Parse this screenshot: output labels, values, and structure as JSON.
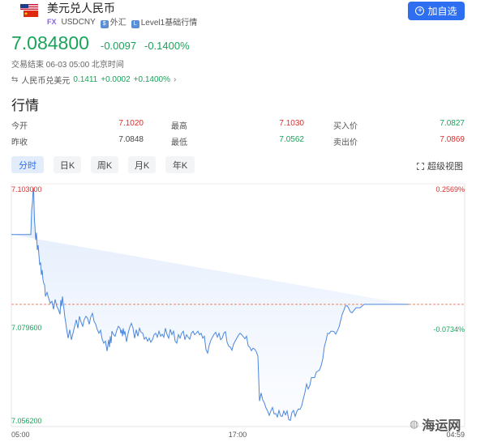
{
  "header": {
    "title": "美元兑人民币",
    "market_tag": "FX",
    "symbol": "USDCNY",
    "category": "外汇",
    "level_label": "Level1基础行情",
    "add_button": "加自选"
  },
  "quote": {
    "price": "7.084800",
    "change": "-0.0097",
    "change_pct": "-0.1400%",
    "status": "交易结束 06-03 05:00 北京时间"
  },
  "inverse": {
    "label": "人民币兑美元",
    "price": "0.1411",
    "change": "+0.0002",
    "change_pct": "+0.1400%"
  },
  "section_title": "行情",
  "stats": {
    "open_label": "今开",
    "open": "7.1020",
    "high_label": "最高",
    "high": "7.1030",
    "bid_label": "买入价",
    "bid": "7.0827",
    "prev_label": "昨收",
    "prev": "7.0848",
    "low_label": "最低",
    "low": "7.0562",
    "ask_label": "卖出价",
    "ask": "7.0869"
  },
  "tabs": [
    "分时",
    "日K",
    "周K",
    "月K",
    "年K"
  ],
  "super_view": "超级视图",
  "watermark": "海运网",
  "colors": {
    "up": "#d93030",
    "down": "#1aa35b",
    "accent": "#2d6ff0",
    "line": "#4a86e0"
  },
  "chart_data": {
    "type": "line",
    "y_left_labels": [
      "7.103000",
      "7.079600",
      "7.056200"
    ],
    "y_right_labels": [
      "0.2569%",
      "-0.0734%"
    ],
    "x_labels": [
      "05:00",
      "17:00",
      "04:59"
    ],
    "ylim": [
      7.0562,
      7.103
    ],
    "reference": 7.0796,
    "x": [
      0,
      24,
      25,
      26,
      27,
      27.5,
      28,
      28.5,
      29,
      29.5,
      30,
      31,
      32,
      33,
      34,
      35,
      36,
      37,
      38,
      39,
      40,
      41,
      42,
      44,
      46,
      48,
      50,
      52,
      54,
      56,
      58,
      60,
      61,
      62,
      63,
      64,
      65,
      66,
      67,
      68,
      69,
      70,
      72,
      74,
      76,
      78,
      80,
      82,
      84,
      86,
      88,
      90,
      92,
      94,
      96,
      98,
      100,
      102,
      104,
      106,
      108,
      110,
      112,
      114,
      116,
      118,
      120,
      121,
      122,
      123,
      124,
      126,
      128,
      130,
      132,
      134,
      135,
      136,
      137,
      138,
      139,
      140,
      142,
      144,
      146,
      148,
      150,
      152,
      154,
      156,
      158,
      160,
      162,
      164,
      166,
      168,
      170,
      172,
      174,
      176,
      178,
      180,
      182,
      184,
      186,
      188,
      190,
      192,
      194,
      196,
      198,
      200,
      202,
      204,
      206,
      208,
      210,
      212,
      214,
      216,
      218,
      220,
      222,
      224,
      226,
      228,
      230,
      232,
      234,
      236,
      238,
      240,
      242,
      244,
      246,
      248,
      250,
      252,
      254,
      256,
      258,
      260,
      262,
      264,
      266,
      268,
      270,
      272,
      274,
      276,
      278,
      280,
      282,
      284,
      286,
      288,
      290,
      292,
      294,
      296,
      298,
      300,
      302,
      304,
      306,
      308,
      310,
      312,
      314,
      316,
      318,
      320,
      322,
      324,
      326,
      328,
      330,
      332,
      334,
      336,
      338,
      340,
      342,
      344,
      346,
      348,
      350,
      352,
      354,
      356,
      358,
      360,
      362,
      364,
      366,
      368,
      370,
      372,
      374,
      376,
      378,
      380,
      382,
      384,
      386,
      388,
      390,
      392,
      394,
      396,
      398,
      400,
      402,
      404,
      406,
      408,
      410,
      412,
      414,
      416,
      418,
      420,
      425,
      430,
      435,
      440,
      445,
      450,
      455,
      460,
      470,
      480,
      490,
      500,
      510,
      519
    ],
    "values": [
      7.0936,
      7.0936,
      7.0985,
      7.1,
      7.103,
      7.1025,
      7.0995,
      7.0965,
      7.0955,
      7.094,
      7.0925,
      7.094,
      7.0905,
      7.0915,
      7.0895,
      7.0875,
      7.088,
      7.0855,
      7.0865,
      7.0845,
      7.0838,
      7.0835,
      7.0812,
      7.082,
      7.0808,
      7.0798,
      7.0802,
      7.0786,
      7.0806,
      7.0792,
      7.0786,
      7.0776,
      7.0805,
      7.0792,
      7.0812,
      7.0798,
      7.0785,
      7.077,
      7.076,
      7.0748,
      7.0738,
      7.0728,
      7.0745,
      7.0725,
      7.0738,
      7.0752,
      7.0765,
      7.0748,
      7.0772,
      7.076,
      7.0752,
      7.0766,
      7.0772,
      7.0768,
      7.0756,
      7.0771,
      7.0778,
      7.0762,
      7.0756,
      7.0745,
      7.0738,
      7.0744,
      7.0726,
      7.0718,
      7.0722,
      7.0702,
      7.0725,
      7.071,
      7.0732,
      7.0718,
      7.0742,
      7.0735,
      7.0732,
      7.0744,
      7.0752,
      7.0748,
      7.0738,
      7.0745,
      7.0732,
      7.0748,
      7.0735,
      7.0742,
      7.0721,
      7.0738,
      7.075,
      7.0758,
      7.0748,
      7.0728,
      7.0745,
      7.0732,
      7.0748,
      7.074,
      7.0738,
      7.0726,
      7.073,
      7.0722,
      7.0728,
      7.072,
      7.0725,
      7.0735,
      7.0738,
      7.073,
      7.0742,
      7.0732,
      7.0736,
      7.073,
      7.0748,
      7.0735,
      7.0728,
      7.0746,
      7.0735,
      7.0742,
      7.0722,
      7.0718,
      7.0735,
      7.0728,
      7.0738,
      7.0742,
      7.0725,
      7.0735,
      7.073,
      7.0726,
      7.0738,
      7.0742,
      7.0735,
      7.0738,
      7.0742,
      7.0735,
      7.0738,
      7.0728,
      7.0732,
      7.0705,
      7.0698,
      7.0714,
      7.0724,
      7.073,
      7.0736,
      7.074,
      7.073,
      7.0738,
      7.0725,
      7.0728,
      7.0738,
      7.0741,
      7.072,
      7.0712,
      7.071,
      7.0704,
      7.0716,
      7.0722,
      7.0728,
      7.0734,
      7.0738,
      7.0735,
      7.0731,
      7.0727,
      7.0732,
      7.0713,
      7.071,
      7.0703,
      7.0708,
      7.0706,
      7.0701,
      7.0692,
      7.0602,
      7.0618,
      7.0604,
      7.0598,
      7.0588,
      7.0582,
      7.0573,
      7.0582,
      7.0589,
      7.0576,
      7.0577,
      7.057,
      7.0583,
      7.0572,
      7.0571,
      7.0582,
      7.0574,
      7.0582,
      7.0565,
      7.0563,
      7.0579,
      7.0583,
      7.0571,
      7.0581,
      7.0586,
      7.0585,
      7.0592,
      7.0606,
      7.0619,
      7.0636,
      7.0626,
      7.0633,
      7.0649,
      7.0649,
      7.0649,
      7.066,
      7.0662,
      7.0664,
      7.0673,
      7.0686,
      7.0711,
      7.0723,
      7.0738,
      7.0737,
      7.0742,
      7.0742,
      7.0741,
      7.0736,
      7.0743,
      7.075,
      7.0763,
      7.0776,
      7.0784,
      7.0793,
      7.0793,
      7.0788,
      7.0781,
      7.0779,
      7.0789,
      7.0789,
      7.0796,
      7.0796,
      7.0796,
      7.0796,
      7.0796,
      7.0796,
      7.0796,
      7.0796,
      7.0796
    ]
  }
}
